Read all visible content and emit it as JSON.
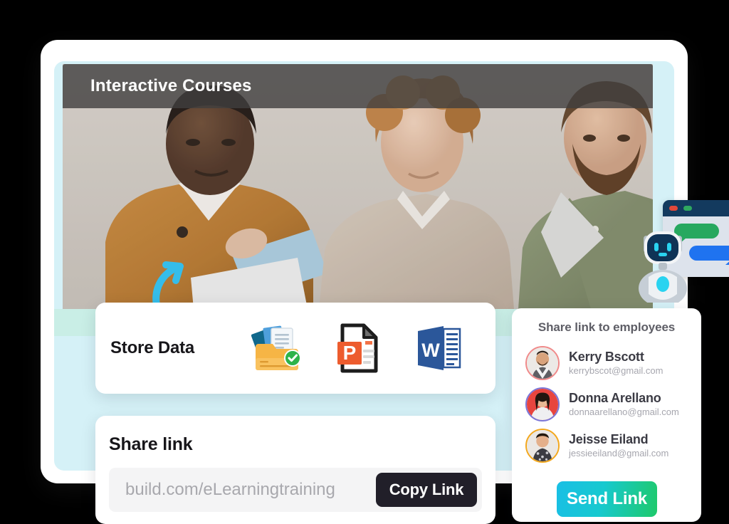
{
  "hero": {
    "title": "Interactive Courses",
    "photo_alt": "three colleagues reviewing documents together",
    "title_bar_color": "#403f3e",
    "panel_bg_color": "#d5f1f7",
    "mint_band_color": "#c9eee6"
  },
  "arrow": {
    "name": "curved-arrow",
    "color": "#35bdea"
  },
  "store_card": {
    "label": "Store Data",
    "icons": [
      {
        "name": "folder-documents-check-icon",
        "label": "Stored files folder"
      },
      {
        "name": "powerpoint-file-icon",
        "label": "PowerPoint",
        "accent": "#ed5c2e"
      },
      {
        "name": "word-file-icon",
        "label": "Word",
        "accent": "#2b579a"
      }
    ]
  },
  "share_link": {
    "title": "Share link",
    "url_value": "build.com/eLearningtraining",
    "url_placeholder": "build.com/eLearningtraining",
    "copy_button": "Copy Link",
    "copy_button_color": "#211f29"
  },
  "employees_panel": {
    "heading": "Share link to employees",
    "send_button": "Send Link",
    "send_button_gradient_from": "#19bfe5",
    "send_button_gradient_to": "#1fc96a",
    "employees": [
      {
        "name": "Kerry Bscott",
        "email": "kerrybscot@gmail.com",
        "avatar_ring_color": "#f08a8a",
        "avatar_bg": "#ece9e6"
      },
      {
        "name": "Donna Arellano",
        "email": "donnaarellano@gmail.com",
        "avatar_ring_color": "#7b77d8",
        "avatar_bg": "#e8453f"
      },
      {
        "name": "Jeisse Eiland",
        "email": "jessieeiland@gmail.com",
        "avatar_ring_color": "#f3a81e",
        "avatar_bg": "#ebe8e4"
      }
    ]
  },
  "chat_widget": {
    "name": "chatbot-widget",
    "window_title_bar_color": "#133a5e",
    "close_dot_color": "#e2483a",
    "minimize_dot_color": "#2fa860",
    "bubbles": [
      {
        "name": "incoming-message-bubble",
        "color": "#27a85f"
      },
      {
        "name": "outgoing-message-bubble",
        "color": "#1f73f0"
      }
    ],
    "robot": {
      "head_color": "#0f3356",
      "eye_color": "#2ad3f0",
      "body_color": "#cfd6dd"
    }
  }
}
